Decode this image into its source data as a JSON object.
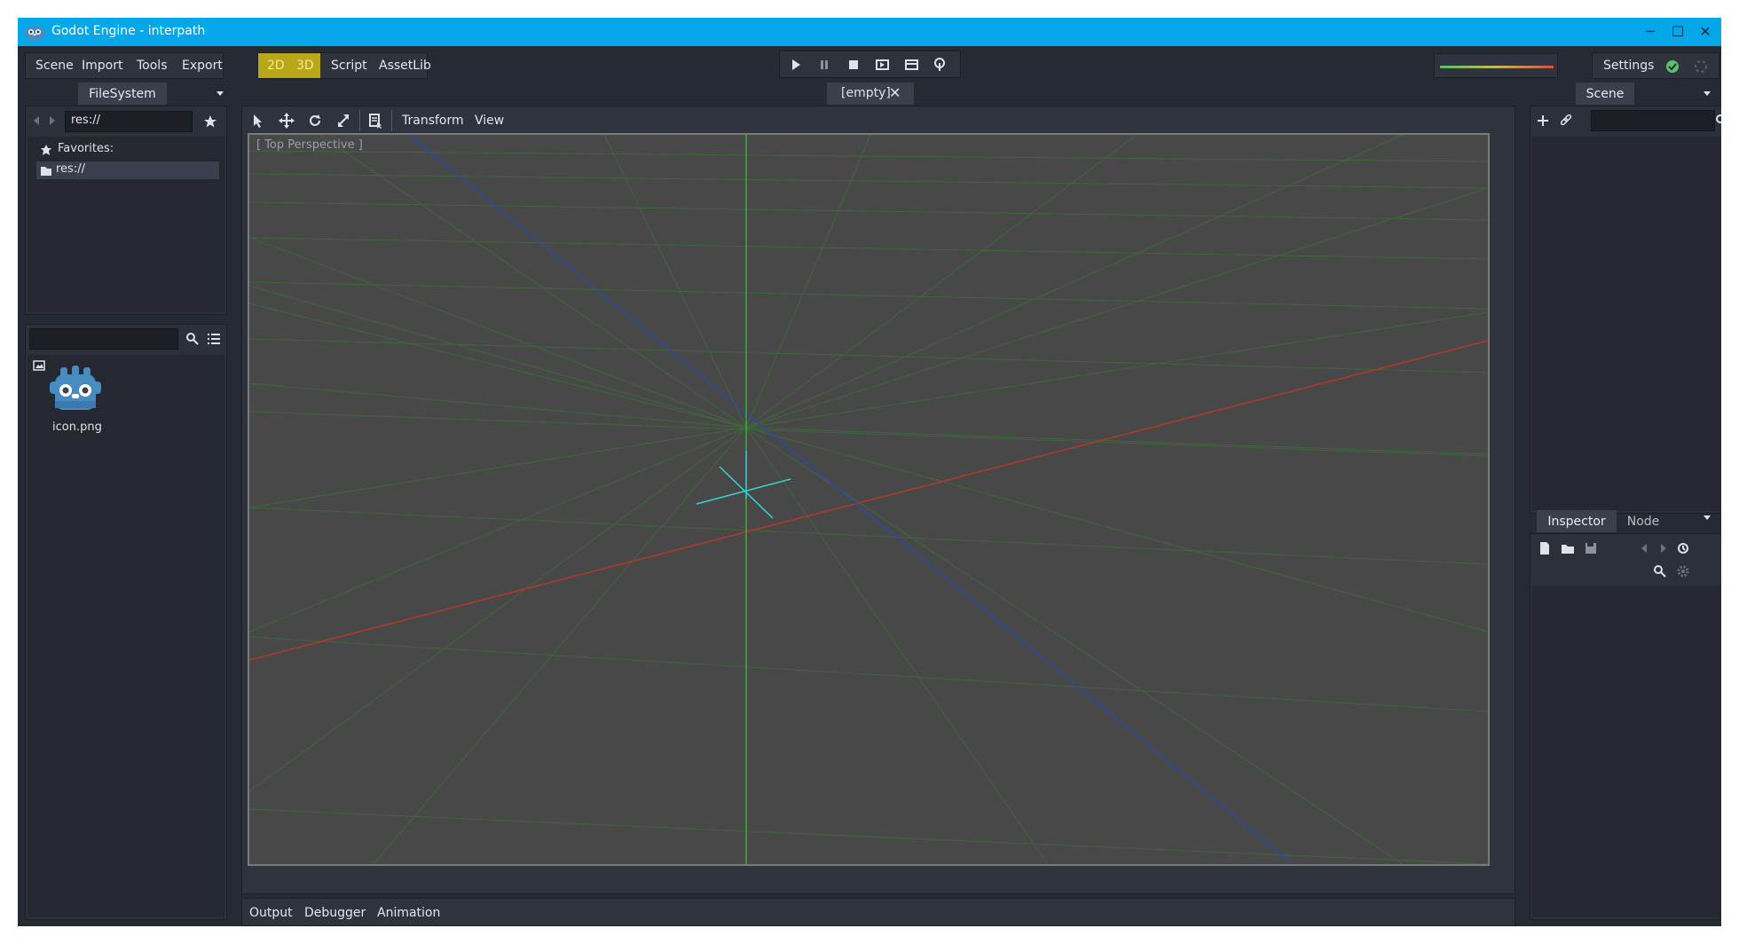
{
  "window": {
    "title": "Godot Engine - interpath",
    "controls": {
      "minimize": "─",
      "maximize": "☐",
      "close": "✕"
    }
  },
  "menu": [
    "Scene",
    "Import",
    "Tools",
    "Export"
  ],
  "modes": [
    "2D",
    "3D",
    "Script",
    "AssetLib"
  ],
  "settings_label": "Settings",
  "scene_tab": {
    "label": "[empty]",
    "close": "✕"
  },
  "filesystem": {
    "tab": "FileSystem",
    "path": "res://",
    "favorites_label": "Favorites:",
    "root_label": "res://",
    "search_placeholder": "",
    "files": [
      {
        "name": "icon.png",
        "type": "image"
      }
    ]
  },
  "viewport": {
    "tools": [
      "select-icon",
      "move-icon",
      "rotate-icon",
      "scale-icon",
      "list-select-icon"
    ],
    "menus": [
      "Transform",
      "View"
    ],
    "perspective_label": "[ Top Perspective ]"
  },
  "scene_dock": {
    "tab": "Scene",
    "search_placeholder": ""
  },
  "inspector_dock": {
    "tabs": [
      "Inspector",
      "Node"
    ]
  },
  "bottom_panel": [
    "Output",
    "Debugger",
    "Animation"
  ],
  "colors": {
    "titlebar": "#06a7e8",
    "mode_active": "#c8b51e",
    "viewport_bg": "#484848",
    "grid": "#3e6b3a",
    "axis_x": "#b03a2a",
    "axis_y": "#33e033",
    "axis_z": "#2a4aa8",
    "gizmo": "#37d6d6"
  }
}
